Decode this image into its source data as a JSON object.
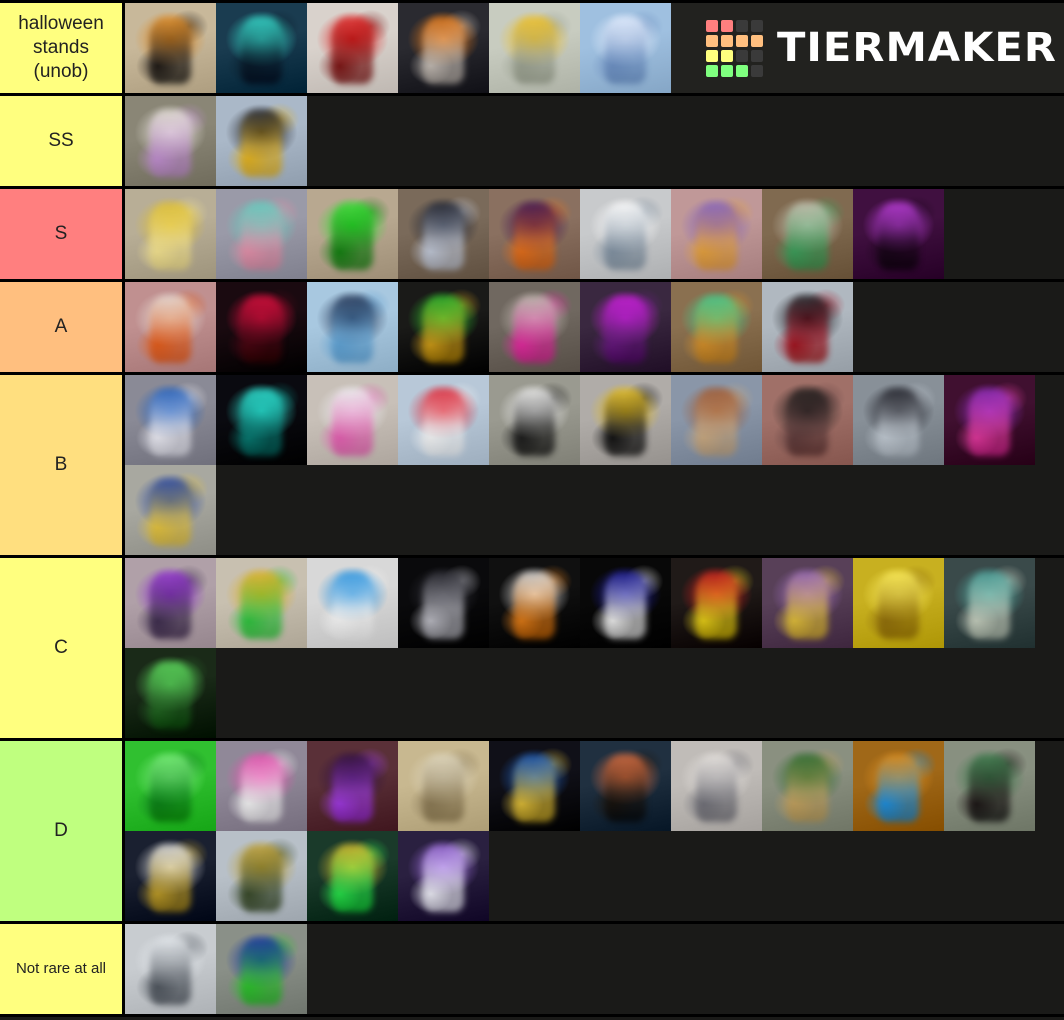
{
  "app": {
    "name": "TierMaker",
    "logo_text": "TIERMAKER",
    "logo_grid_colors": [
      "#ff7f7f",
      "#ff7f7f",
      "#3a3a3a",
      "#3a3a3a",
      "#ffbf7f",
      "#ffbf7f",
      "#ffbf7f",
      "#ffbf7f",
      "#ffff7f",
      "#ffff7f",
      "#3a3a3a",
      "#3a3a3a",
      "#7fff7f",
      "#7fff7f",
      "#7fff7f",
      "#3a3a3a"
    ]
  },
  "colors": {
    "background": "#1a1a18",
    "border": "#000000",
    "tier_red": "#ff7f7f",
    "tier_orange": "#ffbf7f",
    "tier_gold": "#ffdf7f",
    "tier_yellow": "#ffff7f",
    "tier_green": "#bfff7f",
    "label_text": "#222222"
  },
  "tiers": [
    {
      "label": "halloween stands (unob)",
      "color": "#ffff7f",
      "label_size": "normal",
      "has_logo": true,
      "items": [
        {
          "name": "orange-black-armored-stand",
          "a": "#c8b89a",
          "b": "#e08a22",
          "c": "#201a16"
        },
        {
          "name": "teal-glowing-stand",
          "a": "#1a3c50",
          "b": "#38e0d0",
          "c": "#0c2230"
        },
        {
          "name": "red-spiked-stand",
          "a": "#d9d2cc",
          "b": "#e02020",
          "c": "#7a1010"
        },
        {
          "name": "orange-checkered-stand",
          "a": "#2a2a30",
          "b": "#e87a18",
          "c": "#c8c0b8"
        },
        {
          "name": "yellow-small-figure-hallway",
          "a": "#c8ccc0",
          "b": "#f0c020",
          "c": "#9aa090"
        },
        {
          "name": "blue-glowing-bokeh-stand",
          "a": "#9fc0e0",
          "b": "#e8f0ff",
          "c": "#6f90c0"
        }
      ]
    },
    {
      "label": "SS",
      "color": "#ffff7f",
      "label_size": "normal",
      "has_logo": false,
      "items": [
        {
          "name": "white-purple-knight-stand",
          "a": "#8a8676",
          "b": "#e8e4dc",
          "c": "#c090d0"
        },
        {
          "name": "black-gold-winged-stand",
          "a": "#aab8c8",
          "b": "#1a1a20",
          "c": "#e0b020"
        }
      ]
    },
    {
      "label": "S",
      "color": "#ff7f7f",
      "label_size": "normal",
      "has_logo": false,
      "items": [
        {
          "name": "gold-blonde-stand",
          "a": "#b8ae96",
          "b": "#e0c030",
          "c": "#f0e090"
        },
        {
          "name": "teal-pink-stand",
          "a": "#9a9aa8",
          "b": "#60d0c0",
          "c": "#e090a8"
        },
        {
          "name": "green-glowing-stand",
          "a": "#b8a890",
          "b": "#30e030",
          "c": "#108010"
        },
        {
          "name": "dark-blue-hair-stand",
          "a": "#7a6a5a",
          "b": "#1a2030",
          "c": "#c0c8d8"
        },
        {
          "name": "purple-orange-demon-stand",
          "a": "#8a7060",
          "b": "#401050",
          "c": "#e07020"
        },
        {
          "name": "white-burst-stand",
          "a": "#c8cacc",
          "b": "#ffffff",
          "c": "#8090a0"
        },
        {
          "name": "purple-armored-stand",
          "a": "#c09898",
          "b": "#8060c0",
          "c": "#e0a040"
        },
        {
          "name": "green-white-knight-stand",
          "a": "#806a50",
          "b": "#c8c8b8",
          "c": "#40a060"
        },
        {
          "name": "purple-magenta-glow-stand",
          "a": "#401040",
          "b": "#c040e0",
          "c": "#200820"
        }
      ]
    },
    {
      "label": "A",
      "color": "#ffbf7f",
      "label_size": "normal",
      "has_logo": false,
      "items": [
        {
          "name": "pink-orange-fire-stand",
          "a": "#c09090",
          "b": "#e8e0d8",
          "c": "#e06020"
        },
        {
          "name": "black-red-stand",
          "a": "#1a0a10",
          "b": "#e01040",
          "c": "#500818"
        },
        {
          "name": "blue-sword-stand",
          "a": "#a8c8e0",
          "b": "#203050",
          "c": "#60a0d0"
        },
        {
          "name": "green-gold-frog-stand",
          "a": "#1a1a18",
          "b": "#30c030",
          "c": "#d0a020"
        },
        {
          "name": "silver-pink-eye-stand",
          "a": "#706860",
          "b": "#c8c0b8",
          "c": "#e030a0"
        },
        {
          "name": "magenta-purple-stand",
          "a": "#3a2840",
          "b": "#d020e0",
          "c": "#6a2080"
        },
        {
          "name": "green-gold-armor-stand",
          "a": "#8a7050",
          "b": "#40d090",
          "c": "#d09030"
        },
        {
          "name": "black-red-coat-stand",
          "a": "#b0b8c0",
          "b": "#18181c",
          "c": "#a01020"
        }
      ]
    },
    {
      "label": "B",
      "color": "#ffdf7f",
      "label_size": "normal",
      "has_logo": false,
      "items": [
        {
          "name": "blue-white-samurai-stand",
          "a": "#8a8a96",
          "b": "#2060c0",
          "c": "#e8e8f0"
        },
        {
          "name": "cyan-glowing-stand",
          "a": "#0a0a10",
          "b": "#30e8d8",
          "c": "#0c8078"
        },
        {
          "name": "white-pink-gem-stand",
          "a": "#c8c0b8",
          "b": "#f0f0f4",
          "c": "#e060b0"
        },
        {
          "name": "red-white-pattern-stand",
          "a": "#b8c8d8",
          "b": "#e02030",
          "c": "#f0f0f0"
        },
        {
          "name": "black-white-diamond-stand",
          "a": "#9a9a90",
          "b": "#f0f0f0",
          "c": "#202020"
        },
        {
          "name": "yellow-black-stand",
          "a": "#b0aca8",
          "b": "#e8c020",
          "c": "#101010"
        },
        {
          "name": "brown-hair-shirtless-stand",
          "a": "#8a96a8",
          "b": "#a05830",
          "c": "#c8a880"
        },
        {
          "name": "dark-ninja-stand",
          "a": "#a07068",
          "b": "#181818",
          "c": "#604040"
        },
        {
          "name": "dark-figure-sword-stand",
          "a": "#889098",
          "b": "#1a1a22",
          "c": "#c0c8d0"
        },
        {
          "name": "purple-monster-stand",
          "a": "#401030",
          "b": "#9030c0",
          "c": "#e040a0"
        },
        {
          "name": "blue-gold-knight-stand",
          "a": "#a8a8a0",
          "b": "#2040a0",
          "c": "#e0c040"
        }
      ]
    },
    {
      "label": "C",
      "color": "#ffff7f",
      "label_size": "normal",
      "has_logo": false,
      "items": [
        {
          "name": "purple-pink-stand",
          "a": "#b0a0a8",
          "b": "#9030d0",
          "c": "#403050"
        },
        {
          "name": "gold-green-stand",
          "a": "#c8c0b0",
          "b": "#e0b020",
          "c": "#30c040"
        },
        {
          "name": "blue-white-stand",
          "a": "#d8d8d8",
          "b": "#2090e0",
          "c": "#f0f0f0"
        },
        {
          "name": "black-skeleton-stand",
          "a": "#0a0a0c",
          "b": "#303038",
          "c": "#c0c0c8"
        },
        {
          "name": "white-orange-armor-stand",
          "a": "#101010",
          "b": "#e8e8e8",
          "c": "#e08020"
        },
        {
          "name": "dark-blue-white-stand",
          "a": "#080808",
          "b": "#2020a0",
          "c": "#f0f0f0"
        },
        {
          "name": "red-masked-stand",
          "a": "#201a18",
          "b": "#d02020",
          "c": "#e8d020"
        },
        {
          "name": "purple-gold-stand",
          "a": "#584058",
          "b": "#a070c0",
          "c": "#e0c040"
        },
        {
          "name": "yellow-glow-stand",
          "a": "#c8b020",
          "b": "#fff060",
          "c": "#907010"
        },
        {
          "name": "teal-patterned-stand",
          "a": "#3a4a4a",
          "b": "#50a8a0",
          "c": "#c8d0c0"
        },
        {
          "name": "green-glowing-figure-stand",
          "a": "#1a2a18",
          "b": "#60e060",
          "c": "#2a6a2a"
        }
      ]
    },
    {
      "label": "D",
      "color": "#bfff7f",
      "label_size": "normal",
      "has_logo": false,
      "items": [
        {
          "name": "green-bright-stand",
          "a": "#30c030",
          "b": "#80f080",
          "c": "#108020"
        },
        {
          "name": "pink-white-stand",
          "a": "#908898",
          "b": "#e850b0",
          "c": "#f0f0f0"
        },
        {
          "name": "purple-dark-stand",
          "a": "#5a3038",
          "b": "#301040",
          "c": "#a040e0"
        },
        {
          "name": "tan-wooden-scene",
          "a": "#c8b890",
          "b": "#e0d8c0",
          "c": "#8a7a58"
        },
        {
          "name": "blue-gold-knight-stand-2",
          "a": "#101018",
          "b": "#2060c0",
          "c": "#e0c040"
        },
        {
          "name": "gun-orange-scene",
          "a": "#203040",
          "b": "#e07040",
          "c": "#201810"
        },
        {
          "name": "small-figure-doorway",
          "a": "#c0bcb8",
          "b": "#e8e4e0",
          "c": "#707078"
        },
        {
          "name": "green-bag-stand",
          "a": "#8a9080",
          "b": "#2a6a2a",
          "c": "#c0a060"
        },
        {
          "name": "orange-blue-portal-stand",
          "a": "#a06818",
          "b": "#e09020",
          "c": "#2090e0"
        },
        {
          "name": "green-afro-stand",
          "a": "#889080",
          "b": "#3a7a4a",
          "c": "#201818"
        },
        {
          "name": "white-gold-armor-stand",
          "a": "#1a2030",
          "b": "#e8e8e8",
          "c": "#c0a030"
        },
        {
          "name": "gold-green-figure-stand",
          "a": "#b8c0c8",
          "b": "#c0a030",
          "c": "#3a4a2a"
        },
        {
          "name": "gold-green-glow-stand",
          "a": "#1a3a2a",
          "b": "#e0c030",
          "c": "#30e050"
        },
        {
          "name": "purple-white-stand",
          "a": "#2a2040",
          "b": "#a070e0",
          "c": "#f0f0f8"
        }
      ]
    },
    {
      "label": "Not rare at all",
      "color": "#ffff7f",
      "label_size": "small",
      "has_logo": false,
      "items": [
        {
          "name": "gray-snowy-scene",
          "a": "#c8ccd0",
          "b": "#e8ecf0",
          "c": "#50565e"
        },
        {
          "name": "blue-suit-figure",
          "a": "#8a9088",
          "b": "#1030a0",
          "c": "#30c030"
        }
      ]
    }
  ]
}
